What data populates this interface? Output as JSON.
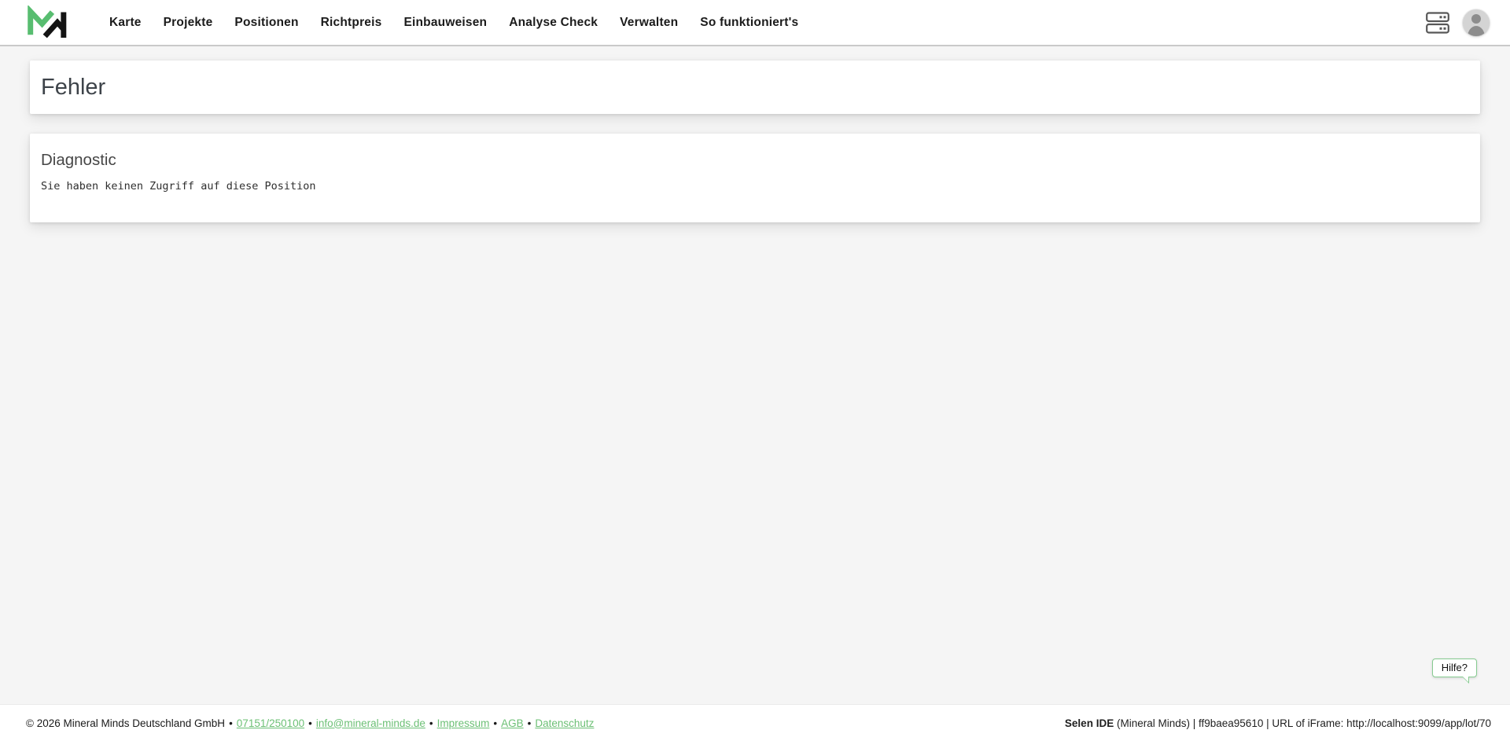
{
  "app": {
    "name": "Mineral Minds",
    "logo_icon": "mineral-minds-logo",
    "logo_colors": {
      "green": "#58bd70",
      "black": "#141414"
    }
  },
  "nav": {
    "items": [
      "Karte",
      "Projekte",
      "Positionen",
      "Richtpreis",
      "Einbauweisen",
      "Analyse Check",
      "Verwalten",
      "So funktioniert's"
    ]
  },
  "header_icons": {
    "server_icon": "server-icon",
    "avatar_icon": "user-avatar-icon"
  },
  "page": {
    "title": "Fehler"
  },
  "diagnostic": {
    "heading": "Diagnostic",
    "message": "Sie haben keinen Zugriff auf diese Position"
  },
  "help": {
    "label": "Hilfe?"
  },
  "footer": {
    "copyright": "© 2026 Mineral Minds Deutschland GmbH",
    "separator": "•",
    "links": [
      "07151/250100",
      "info@mineral-minds.de",
      "Impressum",
      "AGB",
      "Datenschutz"
    ],
    "right": {
      "app": "Selen IDE",
      "rest": "(Mineral Minds) | ff9baea95610 | URL of iFrame: http://localhost:9099/app/lot/70"
    }
  },
  "colors": {
    "accent_green": "#58bd70",
    "link_green": "#6cc075",
    "help_border": "#86cb90",
    "page_background": "#f5f5f5",
    "title_text": "#3d4349"
  }
}
